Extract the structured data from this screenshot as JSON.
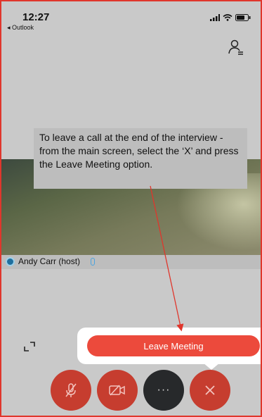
{
  "status": {
    "time": "12:27",
    "back_app": "◂ Outlook"
  },
  "tooltip": {
    "text": "To leave a call at the end of the interview - from the main screen, select the ‘X’ and press the Leave Meeting option."
  },
  "host": {
    "label": "Andy Carr (host)"
  },
  "leave": {
    "label": "Leave Meeting"
  },
  "controls": {
    "more_label": "···"
  },
  "colors": {
    "accent": "#ec4a3c",
    "border": "#e0362c",
    "control_red": "#c63d2f",
    "control_dark": "#27292b"
  }
}
